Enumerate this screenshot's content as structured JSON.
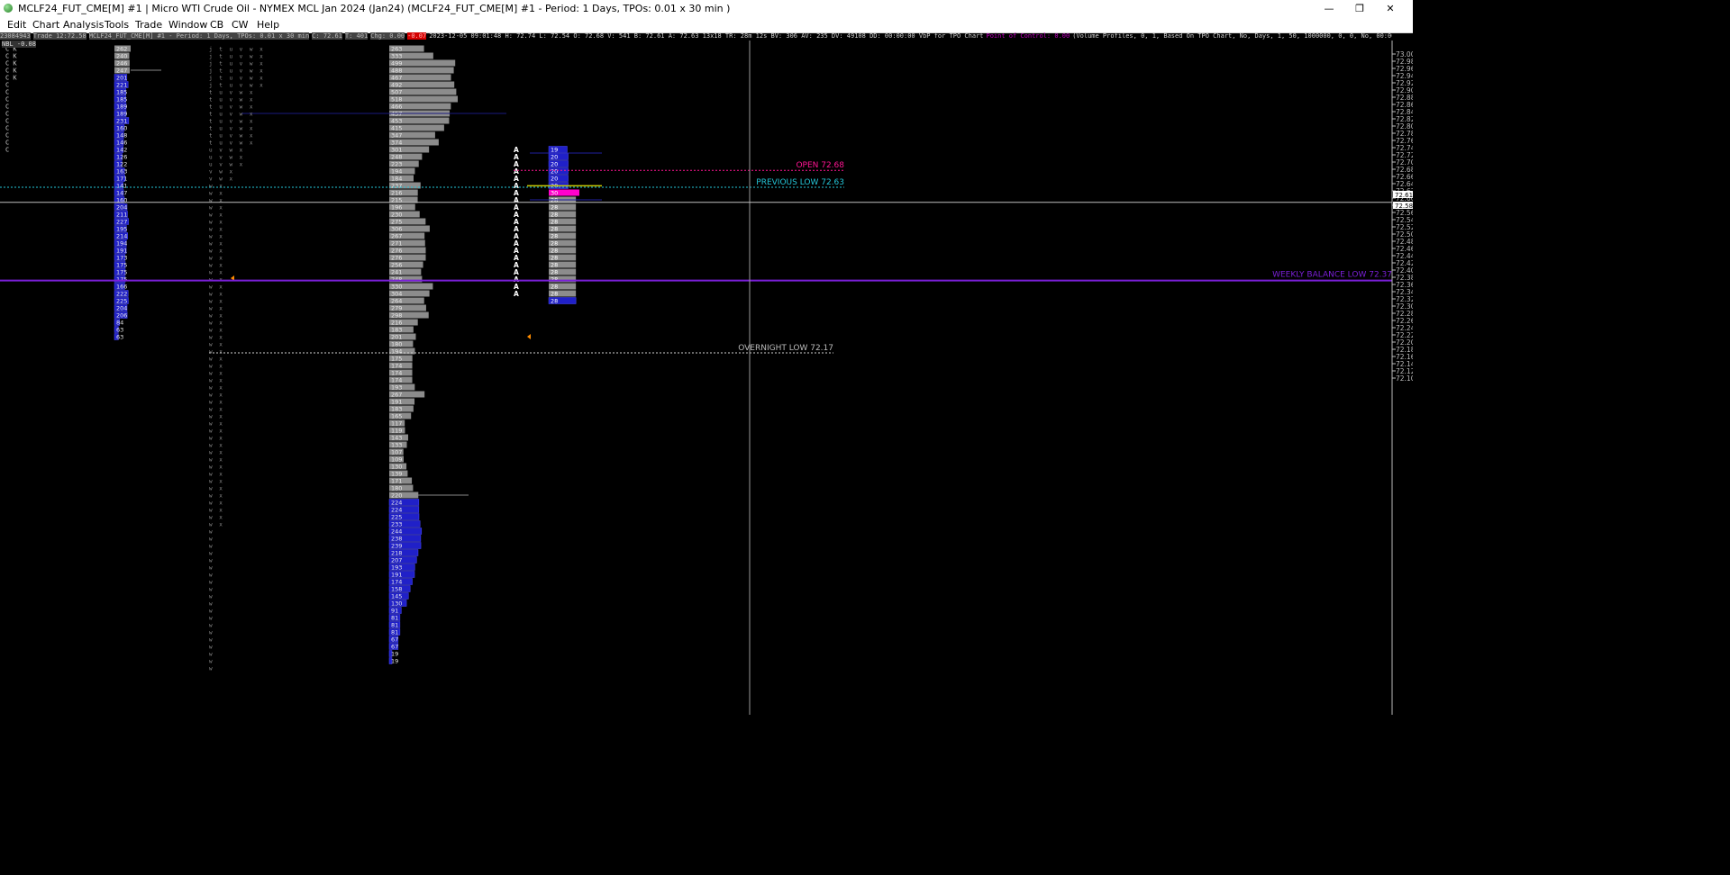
{
  "window": {
    "title": "MCLF24_FUT_CME[M] #1 | Micro WTI Crude Oil - NYMEX MCL Jan 2024 (Jan24) (MCLF24_FUT_CME[M] #1 - Period: 1 Days, TPOs: 0.01 x 30 min  )",
    "minimize_glyph": "—",
    "restore_glyph": "❐",
    "close_glyph": "✕"
  },
  "menu": [
    "Edit",
    "Chart",
    "Analysis",
    "Tools",
    "Trade",
    "Window",
    "CB",
    "CW",
    "Help"
  ],
  "infobar": {
    "id": "23084943",
    "trade": "Trade 12:72.58",
    "symbol": "MCLF24_FUT_CME[M] #1 - Period: 1 Days, TPOs: 0.01 x 30 min",
    "c": "C: 72.61",
    "t": "T: 401",
    "chg": "Chg: 0.00",
    "neg": "-0.07",
    "stats": "2023-12-05 09:01:48 H: 72.74 L: 72.54 O: 72.68 V: 541 B: 72.61 A: 72.63 13x18 TR: 28m 12s BV: 306 AV: 235 DV: 49108 DD: 00:00:00 VbP for TPO Chart",
    "poc": "Point of Control: 0.00",
    "study": "(Volume Profiles, 0, 1, Based On TPO Chart, No, Days, 1, 50, 1000000, 0, 0, No, 00:00:00, 0, 00:00:00, No, No, Period Length, 70, No, Total Volume, 0, No, Total Volume, Yes, None, Yes, No, 100, No, 50, Yes, End O"
  },
  "nbl": "NBL -0.08",
  "colors": {
    "bg": "#000000",
    "grid_text": "#bdbdbd",
    "vol_grey": "#8c8c8c",
    "vol_blue": "#2020c8",
    "open": "#ff1493",
    "prev_low": "#24c6d8",
    "weekly": "#7a1fd8",
    "overnight": "#d0d0d0"
  },
  "chart_data": {
    "type": "tpo_volume_profile",
    "y_axis": {
      "min": 72.1,
      "max": 73.0,
      "ticks": [
        "73.00",
        "72.98",
        "72.96",
        "72.94",
        "72.92",
        "72.90",
        "72.88",
        "72.86",
        "72.84",
        "72.82",
        "72.80",
        "72.78",
        "72.76",
        "72.74",
        "72.72",
        "72.70",
        "72.68",
        "72.66",
        "72.64",
        "72.62",
        "72.60",
        "72.58",
        "72.56",
        "72.54",
        "72.52",
        "72.50",
        "72.48",
        "72.46",
        "72.44",
        "72.42",
        "72.40",
        "72.38",
        "72.36",
        "72.34",
        "72.32",
        "72.30",
        "72.28",
        "72.26",
        "72.24",
        "72.22",
        "72.20",
        "72.18",
        "72.16",
        "72.14",
        "72.12",
        "72.10"
      ],
      "labels": [
        "73.00",
        "72.98",
        "72.96",
        "72.94",
        "72.92",
        "72.90",
        "72.88",
        "72.86",
        "72.84",
        "72.82",
        "72.80",
        "72.78",
        "72.76",
        "72.74",
        "72.72",
        "72.70",
        "72.68",
        "72.66",
        "72.64",
        "72.62",
        "72.60",
        "72.58",
        "72.56",
        "72.54",
        "72.52",
        "72.50",
        "72.48",
        "72.46",
        "72.44",
        "72.42",
        "72.40",
        "72.38",
        "72.36",
        "72.34",
        "72.32",
        "72.30",
        "72.28",
        "72.26",
        "72.24",
        "72.22",
        "72.20",
        "72.18",
        "72.16",
        "72.14",
        "72.12",
        "72.10"
      ],
      "current_markers": [
        "72.61",
        "72.58"
      ]
    },
    "levels": [
      {
        "name": "open",
        "label": "OPEN  72.68",
        "price": 72.677
      },
      {
        "name": "previous-low",
        "label": "PREVIOUS LOW  72.63",
        "price": 72.63
      },
      {
        "name": "weekly-balance-low",
        "label": "WEEKLY BALANCE LOW  72.37",
        "price": 72.371
      },
      {
        "name": "overnight-low",
        "label": "OVERNIGHT LOW  72.17",
        "price": 72.17
      }
    ],
    "crosshair": {
      "price": 72.588
    },
    "profile_a": {
      "top": 73.025,
      "grey": [
        "263",
        "333",
        "499",
        "488",
        "467",
        "492",
        "507",
        "518",
        "466",
        "457",
        "453",
        "415",
        "347",
        "374",
        "301",
        "248",
        "223",
        "194",
        "184",
        "237",
        "216",
        "215",
        "196",
        "230",
        "275",
        "306",
        "267",
        "271",
        "276",
        "276",
        "256",
        "241",
        "248",
        "330",
        "304",
        "264",
        "279",
        "298",
        "216",
        "183",
        "201",
        "180",
        "194",
        "175",
        "174",
        "174",
        "174",
        "193",
        "267",
        "191",
        "183",
        "165",
        "117",
        "119",
        "143",
        "133",
        "107",
        "109",
        "130",
        "139",
        "171",
        "180",
        "220"
      ],
      "blue": [
        "224",
        "224",
        "225",
        "233",
        "244",
        "238",
        "239",
        "218",
        "207",
        "193",
        "191",
        "174",
        "158",
        "145",
        "130",
        "91",
        "81",
        "81",
        "81",
        "67",
        "67",
        "19",
        "19"
      ],
      "poc_line_index": 62
    },
    "profile_b": {
      "top": 73.025,
      "values": [
        "262",
        "240",
        "246",
        "247",
        "201",
        "221",
        "185",
        "185",
        "189",
        "189",
        "231",
        "160",
        "148",
        "146",
        "142",
        "126",
        "122",
        "163",
        "171",
        "141",
        "147",
        "160",
        "204",
        "211",
        "227",
        "195",
        "214",
        "194",
        "191",
        "173",
        "175",
        "175",
        "175",
        "166",
        "222",
        "225",
        "204",
        "206",
        "84",
        "63",
        "63"
      ]
    },
    "profile_c": {
      "top": 72.745,
      "values": [
        "19",
        "20",
        "20",
        "20",
        "20",
        "20",
        "30",
        "28",
        "28",
        "28",
        "28",
        "28",
        "28",
        "28",
        "28",
        "28",
        "28",
        "28",
        "28",
        "28",
        "28",
        "28"
      ],
      "poc_index": 6
    },
    "tpo_col_1": {
      "top": 73.025,
      "rows": [
        "C K",
        "C K",
        "C K",
        "C K",
        "C K",
        "C",
        "C",
        "C",
        "C",
        "C",
        "C",
        "C",
        "C",
        "C",
        "C"
      ]
    },
    "tpo_col_2": {
      "top": 73.025,
      "rows": [
        "j t u v w x",
        "j t u v w x",
        "j t u v w x",
        "j t u v w x",
        "j t u v w x",
        "j t u v w x",
        "t u v w x",
        "t u v w x",
        "t u v w x",
        "t u v w x",
        "t u v w x",
        "t u v w x",
        "t u v w x",
        "t u v w x",
        "u v w x",
        "u v w x",
        "u v w x",
        "v w x",
        "v w x",
        "w x",
        "w x",
        "w x",
        "w x",
        "w x",
        "w x",
        "w x",
        "w x",
        "w x",
        "w x",
        "w x",
        "w x",
        "w x",
        "w x",
        "w x",
        "w x",
        "w x",
        "w x",
        "w x",
        "w x",
        "w x",
        "w x",
        "w x",
        "w x",
        "w x",
        "w x",
        "w x",
        "w x",
        "w x",
        "w x",
        "w x",
        "w x",
        "w x",
        "w x",
        "w x",
        "w x",
        "w x",
        "w x",
        "w x",
        "w x",
        "w x",
        "w x",
        "w x",
        "w x",
        "w x",
        "w x",
        "w x",
        "w x",
        "w",
        "w",
        "w",
        "w",
        "w",
        "w",
        "w",
        "w",
        "w",
        "w",
        "w",
        "w",
        "w",
        "w",
        "w",
        "w",
        "w",
        "w",
        "w",
        "w"
      ]
    },
    "tpo_col_3": {
      "top": 72.745,
      "rows": [
        "A",
        "A",
        "A",
        "A",
        "A",
        "A",
        "A",
        "A",
        "A",
        "A",
        "A",
        "A",
        "A",
        "A",
        "A",
        "A",
        "A",
        "A",
        "A",
        "A",
        "A"
      ]
    }
  }
}
